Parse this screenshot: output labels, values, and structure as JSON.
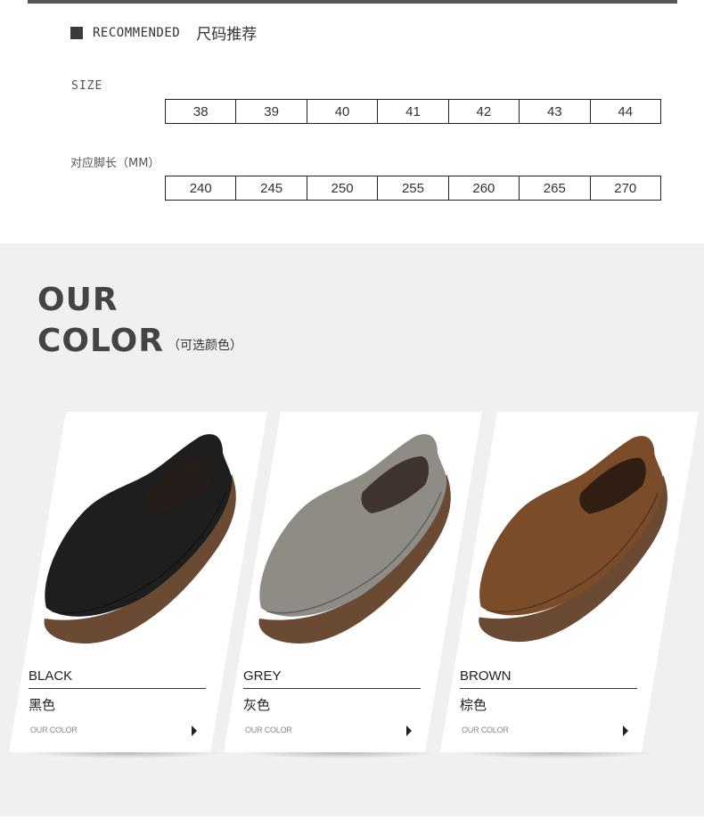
{
  "recommended": {
    "label": "RECOMMENDED",
    "label_cn": "尺码推荐"
  },
  "size_chart": {
    "size_label": "SIZE",
    "foot_label": "对应脚长（MM）",
    "sizes": [
      "38",
      "39",
      "40",
      "41",
      "42",
      "43",
      "44"
    ],
    "lengths": [
      "240",
      "245",
      "250",
      "255",
      "260",
      "265",
      "270"
    ]
  },
  "colors_section": {
    "title_line1": "OUR",
    "title_line2": "COLOR",
    "subtitle": "（可选颜色）",
    "cards": [
      {
        "name": "BLACK",
        "name_cn": "黑色",
        "caption": "OUR COLOR",
        "shoe_color": "#1e1e1e",
        "sole_color": "#6b4a33"
      },
      {
        "name": "GREY",
        "name_cn": "灰色",
        "caption": "OUR COLOR",
        "shoe_color": "#8f8c86",
        "sole_color": "#6b4a33"
      },
      {
        "name": "BROWN",
        "name_cn": "棕色",
        "caption": "OUR COLOR",
        "shoe_color": "#7a4c2a",
        "sole_color": "#6b4a33"
      }
    ]
  }
}
